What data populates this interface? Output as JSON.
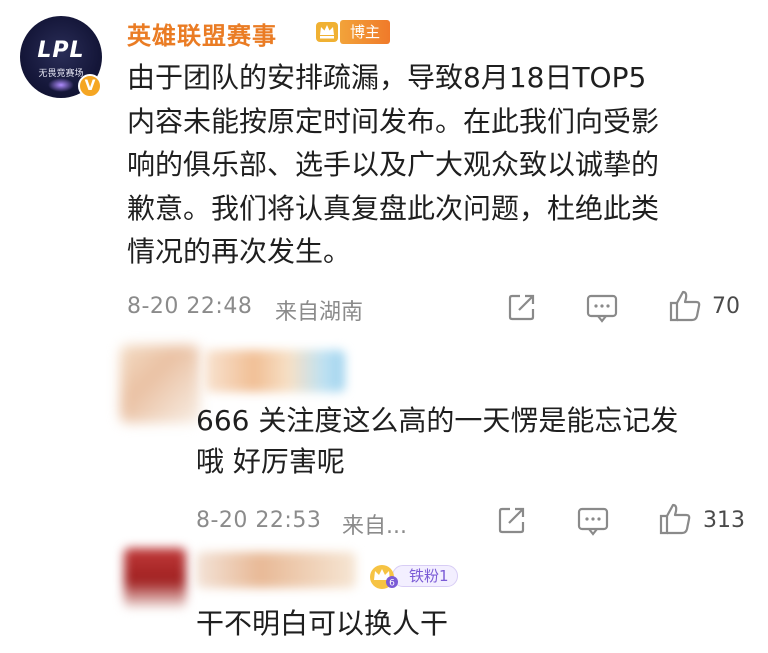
{
  "comments": [
    {
      "avatar": {
        "logo_text": "LPL",
        "sub_text": "无畏竞赛场",
        "verified_mark": "V"
      },
      "username": "英雄联盟赛事",
      "tag": "博主",
      "text": "由于团队的安排疏漏，导致8月18日TOP5\n内容未能按原定时间发布。在此我们向受影\n响的俱乐部、选手以及广大观众致以诚挚的\n歉意。我们将认真复盘此次问题，杜绝此类\n情况的再次发生。",
      "time": "8-20 22:48",
      "location": "来自湖南",
      "likes": "70"
    },
    {
      "text": "666 关注度这么高的一天愣是能忘记发\n哦 好厉害呢",
      "time": "8-20 22:53",
      "location": "来自...",
      "likes": "313"
    },
    {
      "fan_badge": "铁粉1",
      "text": "干不明白可以换人干"
    }
  ],
  "icons": [
    "share-icon",
    "comment-icon",
    "like-icon",
    "level-crown-icon",
    "fan-crown-icon"
  ],
  "colors": {
    "username": "#ea7c24",
    "meta": "#8b8b8b",
    "tag_bg": "#f07a2a",
    "fan_badge": "#7b5bd6"
  }
}
